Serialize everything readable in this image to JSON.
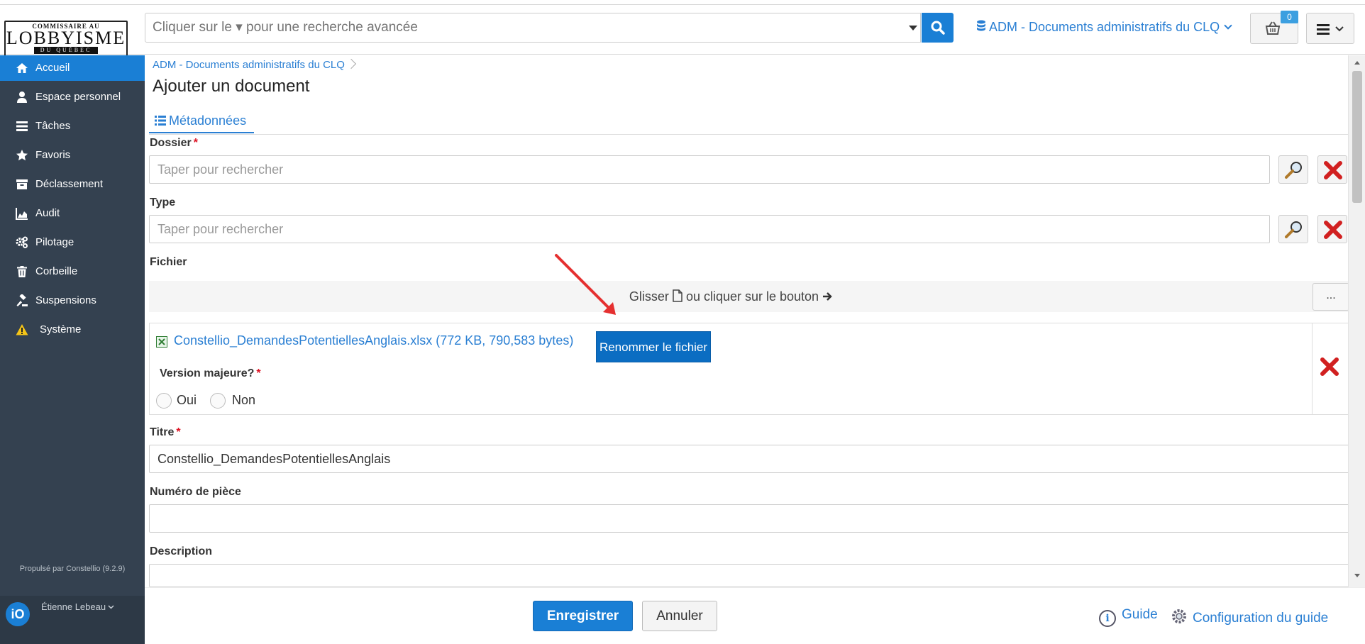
{
  "header": {
    "logo": {
      "line1": "COMMISSAIRE AU",
      "line2": "LOBBYISME",
      "line3": "DU QUÉBEC"
    },
    "search_placeholder": "Cliquer sur le ▾ pour une recherche avancée",
    "collection_label": "ADM - Documents administratifs du CLQ",
    "cart_count": "0"
  },
  "sidebar": {
    "items": [
      {
        "label": "Accueil",
        "icon": "home-icon"
      },
      {
        "label": "Espace personnel",
        "icon": "user-icon"
      },
      {
        "label": "Tâches",
        "icon": "tasks-icon"
      },
      {
        "label": "Favoris",
        "icon": "star-icon"
      },
      {
        "label": "Déclassement",
        "icon": "archive-icon"
      },
      {
        "label": "Audit",
        "icon": "chart-area-icon"
      },
      {
        "label": "Pilotage",
        "icon": "cogs-icon"
      },
      {
        "label": "Corbeille",
        "icon": "trash-icon"
      },
      {
        "label": "Suspensions",
        "icon": "gavel-icon"
      },
      {
        "label": "Système",
        "icon": "warning-icon"
      }
    ],
    "powered_by": "Propulsé par Constellio (9.2.9)",
    "user_name": "Étienne Lebeau",
    "avatar_text": "iO"
  },
  "main": {
    "breadcrumb": "ADM - Documents administratifs du CLQ",
    "title": "Ajouter un document",
    "tab_label": "Métadonnées",
    "dossier": {
      "label": "Dossier",
      "placeholder": "Taper pour rechercher"
    },
    "type": {
      "label": "Type",
      "placeholder": "Taper pour rechercher"
    },
    "fichier": {
      "label": "Fichier",
      "drop_text_1": "Glisser",
      "drop_text_2": "ou cliquer sur le bouton",
      "browse_label": "...",
      "file_link": "Constellio_DemandesPotentiellesAnglais.xlsx (772 KB, 790,583 bytes)",
      "rename_label": "Renommer le fichier",
      "version_label": "Version majeure?",
      "opt_yes": "Oui",
      "opt_no": "Non"
    },
    "titre": {
      "label": "Titre",
      "value": "Constellio_DemandesPotentiellesAnglais"
    },
    "numero": {
      "label": "Numéro de pièce",
      "value": ""
    },
    "description": {
      "label": "Description",
      "value": ""
    }
  },
  "footer": {
    "save_label": "Enregistrer",
    "cancel_label": "Annuler",
    "guide_label": "Guide",
    "config_label": "Configuration du guide"
  },
  "colors": {
    "primary": "#1a7fd5",
    "sidebar": "#344150",
    "danger": "#d12020"
  }
}
